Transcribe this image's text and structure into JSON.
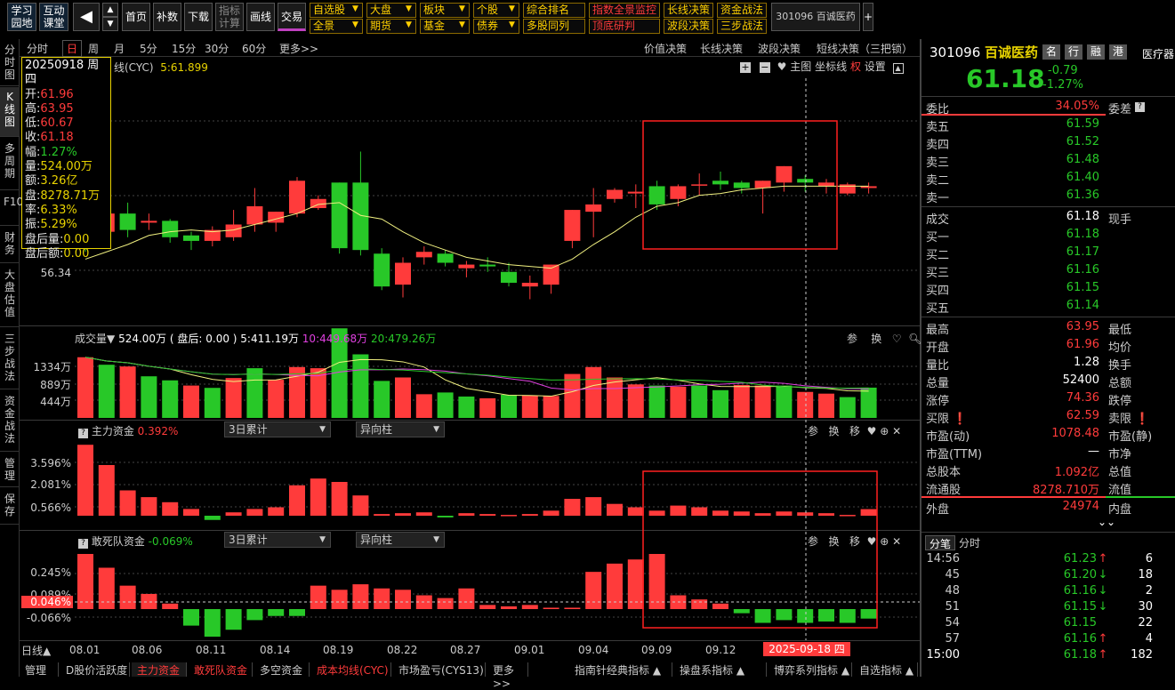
{
  "toolbar": {
    "learn": "学习园地",
    "interactive": "互动课堂",
    "home": "首页",
    "supplement": "补数",
    "download": "下载",
    "indicator_calc": "指标计算",
    "draw": "画线",
    "trade": "交易",
    "menus_row1": [
      "自选股",
      "大盘",
      "板块",
      "个股",
      "综合排名",
      "指数全景监控",
      "长线决策",
      "资金战法"
    ],
    "menus_row2": [
      "全景",
      "期货",
      "基金",
      "债券",
      "多股同列",
      "顶底研判",
      "波段决策",
      "三步战法"
    ],
    "stock_tab": "301096 百诚医药",
    "plus": "+"
  },
  "period_tabs": [
    "分时",
    "日",
    "周",
    "月",
    "5分",
    "15分",
    "30分",
    "60分",
    "更多>>"
  ],
  "decision_tabs": [
    "价值决策",
    "长线决策",
    "波段决策",
    "短线决策（三把锁）"
  ],
  "left_tabs": [
    "分时图",
    "K线图",
    "多周期",
    "F10",
    "财务",
    "大盘估值",
    "三步战法",
    "资金战法",
    "管理",
    "保存"
  ],
  "main_chart": {
    "title": "线(CYC)",
    "ma_label": "5:61.899",
    "right_tools": [
      "主图",
      "坐标线",
      "权",
      "设置"
    ],
    "y_label": "56.34",
    "info": {
      "date": "20250918 周四",
      "open_k": "开",
      "open": "61.96",
      "high_k": "高",
      "high": "63.95",
      "low_k": "低",
      "low": "60.67",
      "close_k": "收",
      "close": "61.18",
      "chg_k": "幅",
      "chg": "1.27%",
      "vol_k": "量",
      "vol": "524.00万",
      "amt_k": "额",
      "amt": "3.26亿",
      "float_k": "盘",
      "float": "8278.71万",
      "turn_k": "率",
      "turn": "6.33%",
      "amp_k": "振",
      "amp": "5.29%",
      "after_vol_k": "盘后量",
      "after_vol": "0.00",
      "after_amt_k": "盘后额",
      "after_amt": "0.00"
    }
  },
  "volume_chart": {
    "title": "成交量▼",
    "v1": "524.00万",
    "after": "( 盘后: 0.00 )",
    "ma5": "5:411.19万",
    "ma10": "10:449.68万",
    "ma20": "20:479.26万",
    "y_labels": [
      "1334万",
      "889万",
      "444万"
    ],
    "tools": [
      "参",
      "换"
    ]
  },
  "main_fund": {
    "title": "主力资金",
    "value": "0.392%",
    "dd1": "3日累计",
    "dd2": "异向柱",
    "y_labels": [
      "3.596%",
      "2.081%",
      "0.566%"
    ],
    "tools": [
      "参",
      "换",
      "移"
    ]
  },
  "dare_fund": {
    "title": "敢死队资金",
    "value": "-0.069%",
    "dd1": "3日累计",
    "dd2": "异向柱",
    "y_labels": [
      "0.245%",
      "0.089%",
      "0.046%",
      "-0.066%"
    ],
    "tools": [
      "参",
      "换",
      "移"
    ]
  },
  "x_axis": {
    "period": "日线▲",
    "dates": [
      "08.01",
      "08.06",
      "08.11",
      "08.14",
      "08.19",
      "08.22",
      "08.27",
      "09.01",
      "09.04",
      "09.09",
      "09.12"
    ],
    "current": "2025-09-18 四"
  },
  "bottom_tabs": [
    "管理",
    "D股价活跃度",
    "主力资金",
    "敢死队资金",
    "多空资金",
    "成本均线(CYC)",
    "市场盈亏(CYS13)",
    "更多>>",
    "指南针经典指标 ▲",
    "操盘系指标 ▲",
    "博弈系列指标 ▲",
    "自选指标 ▲"
  ],
  "quote": {
    "code": "301096",
    "name": "百诚医药",
    "tags": [
      "名",
      "行",
      "融",
      "港"
    ],
    "industry": "医疗器",
    "price": "61.18",
    "change": "-0.79",
    "change_pct": "-1.27%",
    "weibi_label": "委比",
    "weibi": "34.05%",
    "weicha_label": "委差",
    "sells": [
      {
        "l": "卖五",
        "p": "61.59"
      },
      {
        "l": "卖四",
        "p": "61.52"
      },
      {
        "l": "卖三",
        "p": "61.48"
      },
      {
        "l": "卖二",
        "p": "61.40"
      },
      {
        "l": "卖一",
        "p": "61.36"
      }
    ],
    "deal_label": "成交",
    "deal": "61.18",
    "xianshou": "现手",
    "buys": [
      {
        "l": "买一",
        "p": "61.18"
      },
      {
        "l": "买二",
        "p": "61.17"
      },
      {
        "l": "买三",
        "p": "61.16"
      },
      {
        "l": "买四",
        "p": "61.15"
      },
      {
        "l": "买五",
        "p": "61.14"
      }
    ],
    "stats": [
      {
        "l": "最高",
        "v": "63.95",
        "c": "red",
        "r": "最低"
      },
      {
        "l": "开盘",
        "v": "61.96",
        "c": "red",
        "r": "均价"
      },
      {
        "l": "量比",
        "v": "1.28",
        "c": "white",
        "r": "换手"
      },
      {
        "l": "总量",
        "v": "52400",
        "c": "white",
        "r": "总额"
      },
      {
        "l": "涨停",
        "v": "74.36",
        "c": "red",
        "r": "跌停"
      },
      {
        "l": "买限 ❗",
        "v": "62.59",
        "c": "red",
        "r": "卖限 ❗"
      },
      {
        "l": "市盈(动)",
        "v": "1078.48",
        "c": "red",
        "r": "市盈(静)"
      },
      {
        "l": "市盈(TTM)",
        "v": "—",
        "c": "white",
        "r": "市净"
      },
      {
        "l": "总股本",
        "v": "1.092亿",
        "c": "red",
        "r": "总值"
      },
      {
        "l": "流通股",
        "v": "8278.710万",
        "c": "red",
        "r": "流值"
      }
    ],
    "outer_label": "外盘",
    "outer": "24974",
    "inner_label": "内盘",
    "tick_tabs": [
      "分笔",
      "分时"
    ],
    "ticks": [
      {
        "t": "14:56",
        "p": "61.23",
        "a": "↑",
        "ac": "red",
        "v": "6"
      },
      {
        "t": "45",
        "p": "61.20",
        "a": "↓",
        "ac": "green",
        "v": "18"
      },
      {
        "t": "48",
        "p": "61.16",
        "a": "↓",
        "ac": "green",
        "v": "2"
      },
      {
        "t": "51",
        "p": "61.15",
        "a": "↓",
        "ac": "green",
        "v": "30"
      },
      {
        "t": "54",
        "p": "61.15",
        "a": "",
        "ac": "white",
        "v": "22"
      },
      {
        "t": "57",
        "p": "61.16",
        "a": "↑",
        "ac": "red",
        "v": "4"
      },
      {
        "t": "15:00",
        "p": "61.18",
        "a": "↑",
        "ac": "red",
        "v": "182"
      }
    ]
  },
  "colors": {
    "up": "#ff3b3b",
    "down": "#28c828",
    "ma": "#f0f080",
    "bg": "#000000"
  },
  "chart_data": {
    "type": "candlestick",
    "candles": [
      {
        "o": 58.2,
        "h": 58.7,
        "l": 57.5,
        "c": 57.9
      },
      {
        "o": 58.6,
        "h": 59.9,
        "l": 58.3,
        "c": 59.6
      },
      {
        "o": 59.6,
        "h": 60.2,
        "l": 58.3,
        "c": 58.7
      },
      {
        "o": 59.1,
        "h": 59.6,
        "l": 58.7,
        "c": 59.2
      },
      {
        "o": 59.2,
        "h": 59.3,
        "l": 58.0,
        "c": 58.3
      },
      {
        "o": 58.4,
        "h": 58.6,
        "l": 57.6,
        "c": 58.1
      },
      {
        "o": 58.1,
        "h": 58.9,
        "l": 57.8,
        "c": 58.7
      },
      {
        "o": 58.3,
        "h": 59.8,
        "l": 58.1,
        "c": 59.0
      },
      {
        "o": 59.0,
        "h": 61.0,
        "l": 58.6,
        "c": 60.0
      },
      {
        "o": 59.1,
        "h": 59.7,
        "l": 58.6,
        "c": 59.7
      },
      {
        "o": 59.6,
        "h": 61.6,
        "l": 59.4,
        "c": 61.4
      },
      {
        "o": 59.9,
        "h": 60.6,
        "l": 59.8,
        "c": 60.4
      },
      {
        "o": 61.3,
        "h": 60.7,
        "l": 57.4,
        "c": 57.7
      },
      {
        "o": 61.3,
        "h": 63.0,
        "l": 57.3,
        "c": 57.6
      },
      {
        "o": 57.4,
        "h": 57.7,
        "l": 55.4,
        "c": 55.6
      },
      {
        "o": 55.7,
        "h": 57.2,
        "l": 55.0,
        "c": 56.9
      },
      {
        "o": 57.2,
        "h": 57.8,
        "l": 56.8,
        "c": 57.5
      },
      {
        "o": 57.4,
        "h": 57.6,
        "l": 56.7,
        "c": 56.9
      },
      {
        "o": 56.6,
        "h": 57.0,
        "l": 56.1,
        "c": 56.8
      },
      {
        "o": 56.8,
        "h": 57.2,
        "l": 56.4,
        "c": 56.7
      },
      {
        "o": 56.4,
        "h": 56.9,
        "l": 55.6,
        "c": 55.8
      },
      {
        "o": 55.6,
        "h": 56.2,
        "l": 54.9,
        "c": 55.8
      },
      {
        "o": 55.7,
        "h": 56.6,
        "l": 55.2,
        "c": 56.8
      },
      {
        "o": 58.1,
        "h": 58.9,
        "l": 57.7,
        "c": 59.8
      },
      {
        "o": 59.7,
        "h": 61.0,
        "l": 58.3,
        "c": 60.1
      },
      {
        "o": 60.4,
        "h": 61.0,
        "l": 60.2,
        "c": 60.9
      },
      {
        "o": 60.7,
        "h": 61.2,
        "l": 59.9,
        "c": 60.8
      },
      {
        "o": 61.1,
        "h": 61.4,
        "l": 59.8,
        "c": 60.1
      },
      {
        "o": 60.4,
        "h": 61.2,
        "l": 60.0,
        "c": 61.1
      },
      {
        "o": 61.2,
        "h": 61.8,
        "l": 60.6,
        "c": 61.2
      },
      {
        "o": 61.4,
        "h": 61.9,
        "l": 60.9,
        "c": 61.2
      },
      {
        "o": 61.3,
        "h": 61.4,
        "l": 60.7,
        "c": 61.0
      },
      {
        "o": 61.0,
        "h": 61.2,
        "l": 59.6,
        "c": 61.4
      },
      {
        "o": 61.3,
        "h": 61.6,
        "l": 60.8,
        "c": 62.2
      },
      {
        "o": 61.5,
        "h": 61.7,
        "l": 60.8,
        "c": 61.3
      },
      {
        "o": 61.1,
        "h": 61.5,
        "l": 60.7,
        "c": 61.3
      },
      {
        "o": 60.7,
        "h": 61.3,
        "l": 60.6,
        "c": 61.2
      },
      {
        "o": 61.0,
        "h": 61.3,
        "l": 60.7,
        "c": 61.1
      }
    ],
    "ma5": [
      57.1,
      57.5,
      57.9,
      58.4,
      58.6,
      58.7,
      58.6,
      58.7,
      59.0,
      59.3,
      59.6,
      60.1,
      60.2,
      59.5,
      59.3,
      58.6,
      58.0,
      57.6,
      57.2,
      57.0,
      56.8,
      56.7,
      56.6,
      57.1,
      57.9,
      58.6,
      59.4,
      60.0,
      60.2,
      60.6,
      60.7,
      60.9,
      61.0,
      61.1,
      61.1,
      61.1,
      61.1,
      61.1
    ],
    "volume": [
      {
        "v": 1050,
        "up": 1
      },
      {
        "v": 920,
        "up": 0
      },
      {
        "v": 890,
        "up": 1
      },
      {
        "v": 720,
        "up": 0
      },
      {
        "v": 650,
        "up": 0
      },
      {
        "v": 560,
        "up": 1
      },
      {
        "v": 520,
        "up": 0
      },
      {
        "v": 690,
        "up": 1
      },
      {
        "v": 860,
        "up": 0
      },
      {
        "v": 660,
        "up": 1
      },
      {
        "v": 880,
        "up": 1
      },
      {
        "v": 860,
        "up": 1
      },
      {
        "v": 1550,
        "up": 0
      },
      {
        "v": 1100,
        "up": 0
      },
      {
        "v": 640,
        "up": 0
      },
      {
        "v": 700,
        "up": 1
      },
      {
        "v": 410,
        "up": 1
      },
      {
        "v": 440,
        "up": 0
      },
      {
        "v": 370,
        "up": 0
      },
      {
        "v": 340,
        "up": 1
      },
      {
        "v": 400,
        "up": 0
      },
      {
        "v": 390,
        "up": 1
      },
      {
        "v": 380,
        "up": 1
      },
      {
        "v": 760,
        "up": 1
      },
      {
        "v": 880,
        "up": 1
      },
      {
        "v": 700,
        "up": 1
      },
      {
        "v": 580,
        "up": 1
      },
      {
        "v": 560,
        "up": 0
      },
      {
        "v": 540,
        "up": 1
      },
      {
        "v": 560,
        "up": 0
      },
      {
        "v": 480,
        "up": 0
      },
      {
        "v": 570,
        "up": 1
      },
      {
        "v": 560,
        "up": 1
      },
      {
        "v": 560,
        "up": 0
      },
      {
        "v": 450,
        "up": 1
      },
      {
        "v": 420,
        "up": 1
      },
      {
        "v": 360,
        "up": 0
      },
      {
        "v": 524,
        "up": 0
      }
    ],
    "main_fund": [
      4.2,
      3.0,
      1.5,
      1.1,
      0.8,
      0.4,
      -0.25,
      0.2,
      0.4,
      0.5,
      1.8,
      2.2,
      2.0,
      1.2,
      0.1,
      0.15,
      0.2,
      -0.1,
      0.15,
      0.1,
      0.05,
      0.1,
      0.3,
      1.0,
      1.1,
      0.7,
      0.5,
      0.3,
      0.6,
      0.5,
      0.3,
      0.25,
      0.15,
      0.25,
      0.2,
      0.15,
      0.05,
      0.392
    ],
    "dare_fund": [
      0.4,
      0.3,
      0.17,
      0.11,
      0.04,
      -0.12,
      -0.2,
      -0.15,
      -0.08,
      -0.05,
      -0.05,
      0.17,
      0.14,
      0.18,
      0.15,
      0.14,
      0.1,
      0.08,
      0.15,
      0.03,
      0.02,
      0.03,
      0.01,
      0.01,
      0.27,
      0.33,
      0.36,
      0.4,
      0.1,
      0.07,
      0.04,
      -0.03,
      -0.1,
      -0.08,
      -0.1,
      -0.09,
      -0.1,
      -0.069
    ]
  }
}
